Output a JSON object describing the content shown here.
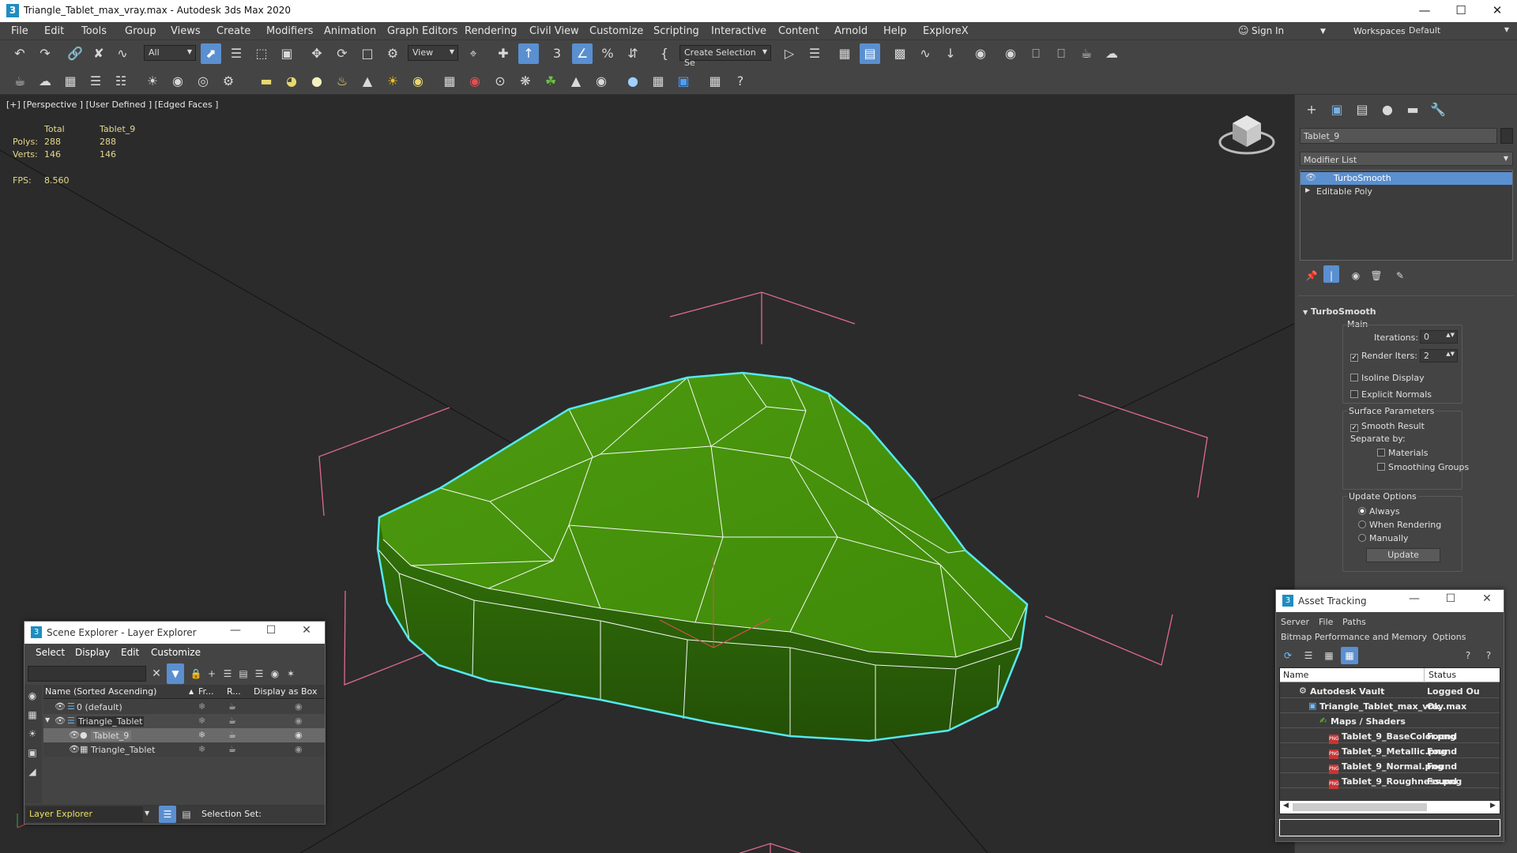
{
  "title": {
    "text": "Triangle_Tablet_max_vray.max - Autodesk 3ds Max 2020",
    "logo": "3"
  },
  "menu": [
    "File",
    "Edit",
    "Tools",
    "Group",
    "Views",
    "Create",
    "Modifiers",
    "Animation",
    "Graph Editors",
    "Rendering",
    "Civil View",
    "Customize",
    "Scripting",
    "Interactive",
    "Content",
    "Arnold",
    "Help",
    "ExploreX"
  ],
  "signin": {
    "label": "Sign In",
    "workspaces_label": "Workspaces:",
    "workspace": "Default"
  },
  "toolbar": {
    "filter": "All",
    "refcoord": "View",
    "selset": "Create Selection Se"
  },
  "viewport": {
    "label": "[+] [Perspective ] [User Defined ] [Edged Faces ]",
    "stats": {
      "total_label": "Total",
      "obj_label": "Tablet_9",
      "polys_label": "Polys:",
      "polys_total": "288",
      "polys_obj": "288",
      "verts_label": "Verts:",
      "verts_total": "146",
      "verts_obj": "146",
      "fps_label": "FPS:",
      "fps": "8.560"
    },
    "colors": {
      "mesh": "#4d9a10",
      "wire": "#ffffff",
      "selection": "#56e8f0",
      "bbox": "#e06b8f",
      "grid": "#101010"
    }
  },
  "cmdpanel": {
    "object_name": "Tablet_9",
    "modifier_list": "Modifier List",
    "stack": [
      "TurboSmooth",
      "Editable Poly"
    ],
    "rollout": "TurboSmooth",
    "main": "Main",
    "iterations_label": "Iterations:",
    "iterations": "0",
    "render_iters_label": "Render Iters:",
    "render_iters": "2",
    "isoline": "Isoline Display",
    "explicit": "Explicit Normals",
    "surface": "Surface Parameters",
    "smooth_result": "Smooth Result",
    "separate_by": "Separate by:",
    "materials": "Materials",
    "smoothing_groups": "Smoothing Groups",
    "update_options": "Update Options",
    "always": "Always",
    "when_rendering": "When Rendering",
    "manually": "Manually",
    "update_btn": "Update"
  },
  "scene_explorer": {
    "title": "Scene Explorer - Layer Explorer",
    "menu": [
      "Select",
      "Display",
      "Edit",
      "Customize"
    ],
    "columns": [
      "Name (Sorted Ascending)",
      "Fr...",
      "R...",
      "Display as Box"
    ],
    "rows": [
      "0 (default)",
      "Triangle_Tablet",
      "Tablet_9",
      "Triangle_Tablet"
    ],
    "footer_label": "Layer Explorer",
    "selection_set": "Selection Set:"
  },
  "asset_tracking": {
    "title": "Asset Tracking",
    "menu1": [
      "Server",
      "File",
      "Paths"
    ],
    "menu2": [
      "Bitmap Performance and Memory",
      "Options"
    ],
    "columns": [
      "Name",
      "Status"
    ],
    "rows": [
      {
        "name": "Autodesk Vault",
        "status": "Logged Ou"
      },
      {
        "name": "Triangle_Tablet_max_vray.max",
        "status": "Ok"
      },
      {
        "name": "Maps / Shaders",
        "status": ""
      },
      {
        "name": "Tablet_9_BaseColor.png",
        "status": "Found"
      },
      {
        "name": "Tablet_9_Metallic.png",
        "status": "Found"
      },
      {
        "name": "Tablet_9_Normal.png",
        "status": "Found"
      },
      {
        "name": "Tablet_9_Roughness.png",
        "status": "Found"
      }
    ]
  }
}
